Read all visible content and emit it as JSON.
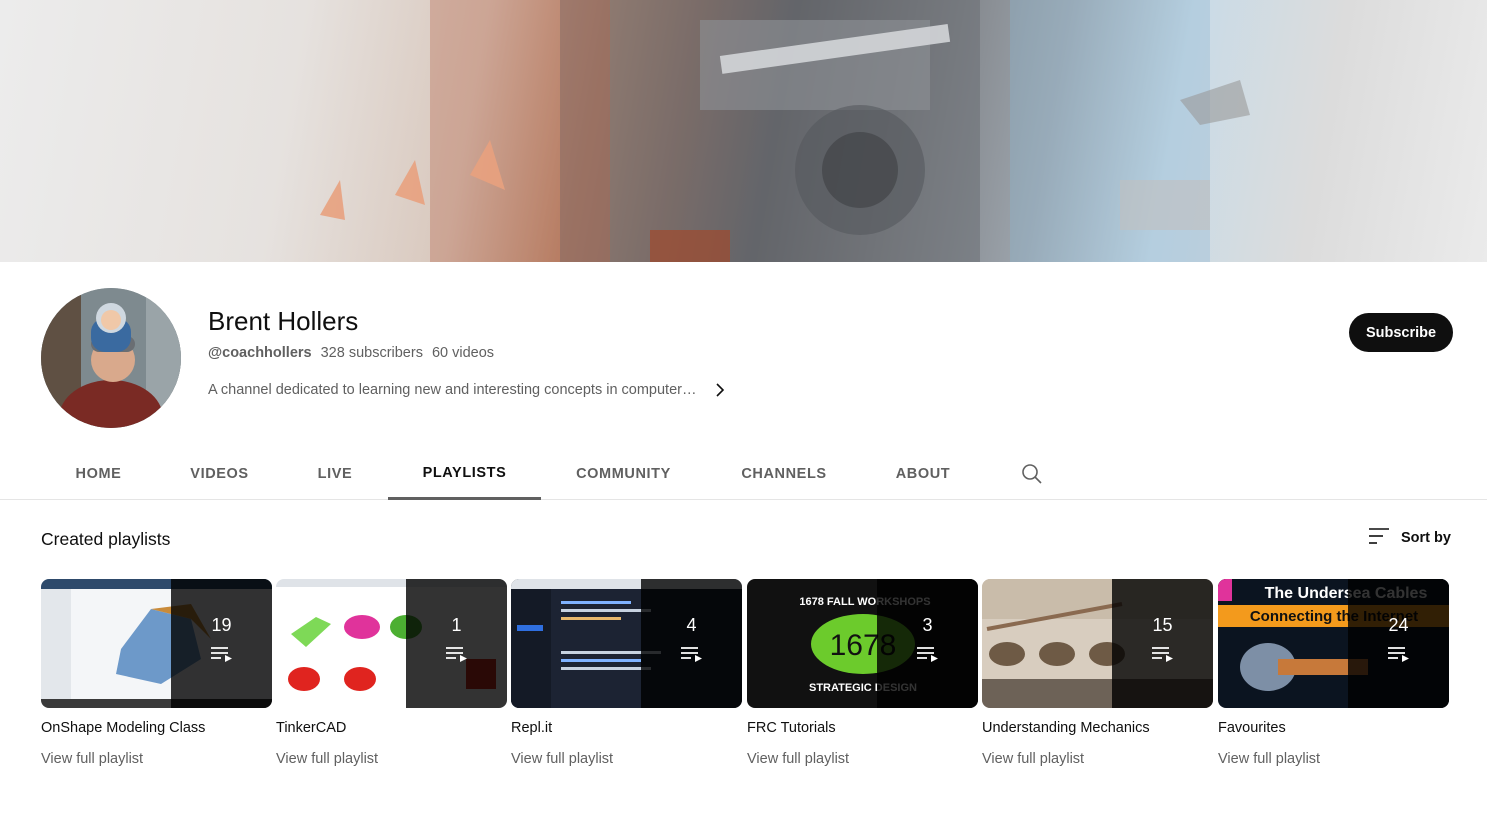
{
  "channel": {
    "name": "Brent Hollers",
    "handle": "@coachhollers",
    "subscribers": "328 subscribers",
    "videos": "60 videos",
    "description": "A channel dedicated to learning new and interesting concepts in computer…",
    "subscribe_label": "Subscribe"
  },
  "tabs": [
    {
      "label": "HOME"
    },
    {
      "label": "VIDEOS"
    },
    {
      "label": "LIVE"
    },
    {
      "label": "PLAYLISTS"
    },
    {
      "label": "COMMUNITY"
    },
    {
      "label": "CHANNELS"
    },
    {
      "label": "ABOUT"
    }
  ],
  "active_tab": "PLAYLISTS",
  "section": {
    "title": "Created playlists",
    "sort_label": "Sort by"
  },
  "playlists": [
    {
      "title": "OnShape Modeling Class",
      "count": "19",
      "link": "View full playlist"
    },
    {
      "title": "TinkerCAD",
      "count": "1",
      "link": "View full playlist"
    },
    {
      "title": "Repl.it",
      "count": "4",
      "link": "View full playlist"
    },
    {
      "title": "FRC Tutorials",
      "count": "3",
      "link": "View full playlist",
      "thumb_text_top": "1678 FALL WORKSHOPS",
      "thumb_text_mid": "1678",
      "thumb_text_bottom": "STRATEGIC DESIGN"
    },
    {
      "title": "Understanding Mechanics",
      "count": "15",
      "link": "View full playlist"
    },
    {
      "title": "Favourites",
      "count": "24",
      "link": "View full playlist",
      "thumb_text_top": "The Undersea Cables",
      "thumb_text_mid": "Connecting the Internet"
    }
  ],
  "colors": {
    "accent": "#0f0f0f",
    "muted_text": "#606060",
    "divider": "#e5e5e5",
    "frc_green": "#6ccb2c",
    "favourites_orange": "#f39a1c"
  },
  "icons": [
    "chevron-right-icon",
    "search-icon",
    "sort-icon",
    "playlist-queue-icon"
  ]
}
